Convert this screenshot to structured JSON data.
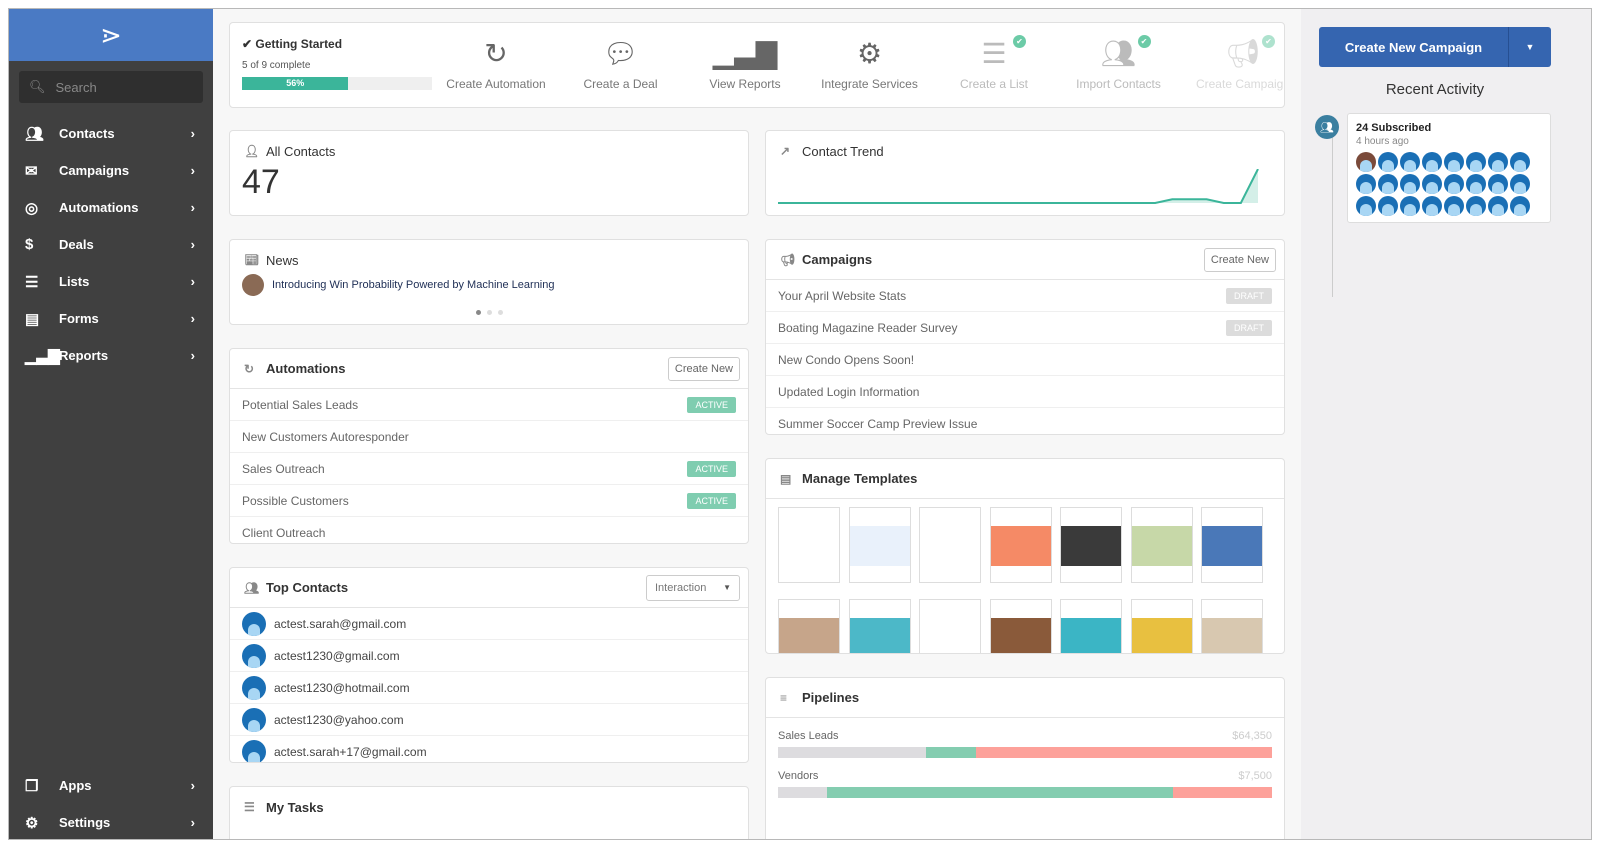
{
  "sidebar": {
    "logo_icon": "activecampaign-chevron-logo",
    "search_placeholder": "Search",
    "items": [
      {
        "label": "Contacts",
        "icon": "contacts-icon"
      },
      {
        "label": "Campaigns",
        "icon": "envelope-icon"
      },
      {
        "label": "Automations",
        "icon": "automation-icon"
      },
      {
        "label": "Deals",
        "icon": "dollar-icon"
      },
      {
        "label": "Lists",
        "icon": "list-icon"
      },
      {
        "label": "Forms",
        "icon": "form-icon"
      },
      {
        "label": "Reports",
        "icon": "bar-chart-icon"
      }
    ],
    "bottom_items": [
      {
        "label": "Apps",
        "icon": "apps-icon"
      },
      {
        "label": "Settings",
        "icon": "gear-icon"
      }
    ]
  },
  "getting_started": {
    "title": "Getting Started",
    "progress_text": "5 of 9 complete",
    "progress_percent": 56,
    "progress_label": "56%",
    "items": [
      {
        "label": "Create Automation",
        "icon": "refresh-icon",
        "done": false
      },
      {
        "label": "Create a Deal",
        "icon": "chat-bubble-icon",
        "done": false
      },
      {
        "label": "View Reports",
        "icon": "bar-chart-icon",
        "done": false
      },
      {
        "label": "Integrate Services",
        "icon": "gear-icon",
        "done": false
      },
      {
        "label": "Create a List",
        "icon": "list-icon",
        "done": true
      },
      {
        "label": "Import Contacts",
        "icon": "users-icon",
        "done": true
      },
      {
        "label": "Create Campaign",
        "icon": "megaphone-icon",
        "done": true
      }
    ]
  },
  "all_contacts": {
    "title": "All Contacts",
    "count": "47"
  },
  "contact_trend": {
    "title": "Contact Trend",
    "values": [
      0,
      0,
      0,
      0,
      0,
      0,
      0,
      0,
      0,
      0,
      0,
      0,
      0,
      0,
      0,
      0,
      0,
      0,
      0,
      0,
      0,
      0,
      0,
      1,
      1,
      1,
      0,
      0,
      9
    ]
  },
  "news": {
    "title": "News",
    "headline": "Introducing Win Probability Powered by Machine Learning",
    "pages": 3,
    "active_page": 1
  },
  "automations": {
    "title": "Automations",
    "create_label": "Create New",
    "items": [
      {
        "name": "Potential Sales Leads",
        "status": "ACTIVE"
      },
      {
        "name": "New Customers Autoresponder",
        "status": ""
      },
      {
        "name": "Sales Outreach",
        "status": "ACTIVE"
      },
      {
        "name": "Possible Customers",
        "status": "ACTIVE"
      },
      {
        "name": "Client Outreach",
        "status": ""
      }
    ]
  },
  "campaigns": {
    "title": "Campaigns",
    "create_label": "Create New",
    "items": [
      {
        "name": "Your April Website Stats",
        "status": "DRAFT"
      },
      {
        "name": "Boating Magazine Reader Survey",
        "status": "DRAFT"
      },
      {
        "name": "New Condo Opens Soon!",
        "status": ""
      },
      {
        "name": "Updated Login Information",
        "status": ""
      },
      {
        "name": "Summer Soccer Camp Preview Issue",
        "status": ""
      }
    ]
  },
  "top_contacts": {
    "title": "Top Contacts",
    "sort_selected": "Interaction",
    "items": [
      "actest.sarah@gmail.com",
      "actest1230@gmail.com",
      "actest1230@hotmail.com",
      "actest1230@yahoo.com",
      "actest.sarah+17@gmail.com"
    ]
  },
  "templates": {
    "title": "Manage Templates",
    "count": 14
  },
  "pipelines": {
    "title": "Pipelines",
    "items": [
      {
        "name": "Sales Leads",
        "value": "$64,350",
        "segments": [
          30,
          10,
          60
        ]
      },
      {
        "name": "Vendors",
        "value": "$7,500",
        "segments": [
          10,
          70,
          20
        ]
      }
    ]
  },
  "my_tasks": {
    "title": "My Tasks"
  },
  "right_rail": {
    "create_button": "Create New Campaign",
    "recent_activity_title": "Recent Activity",
    "activity": {
      "title": "24 Subscribed",
      "time": "4 hours ago",
      "avatar_count": 24
    }
  },
  "colors": {
    "brand_blue": "#3565b0",
    "teal": "#3bb59a",
    "active_badge": "#7fcdb0",
    "draft_badge": "#dcdcdc",
    "pipeline_gray": "#dddcdf",
    "pipeline_green": "#84cdb0",
    "pipeline_red": "#fda19a"
  }
}
